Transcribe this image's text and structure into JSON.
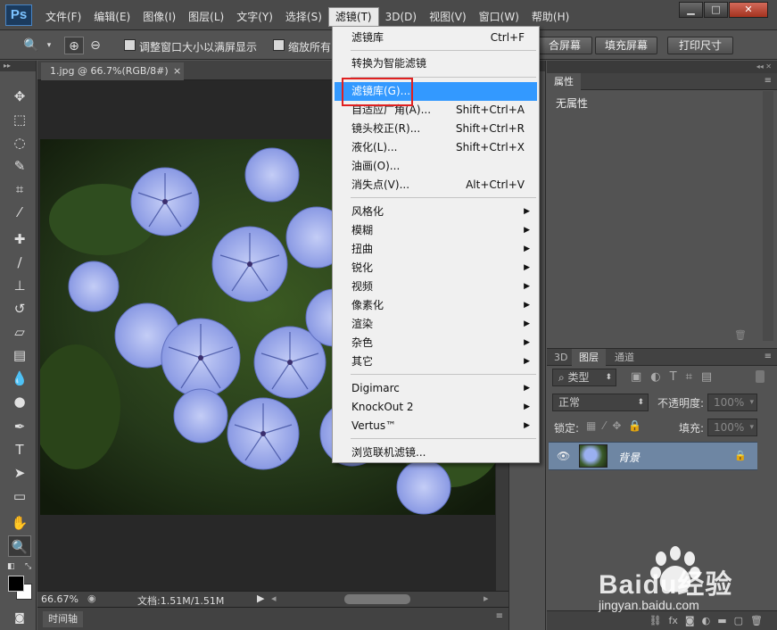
{
  "app": {
    "logo": "Ps"
  },
  "menubar": {
    "items": [
      "文件(F)",
      "编辑(E)",
      "图像(I)",
      "图层(L)",
      "文字(Y)",
      "选择(S)",
      "滤镜(T)",
      "3D(D)",
      "视图(V)",
      "窗口(W)",
      "帮助(H)"
    ],
    "active_index": 6
  },
  "window_controls": {
    "minimize": "▁",
    "maximize": "□",
    "close": "✕"
  },
  "options": {
    "checkbox1_label": "调整窗口大小以满屏显示",
    "checkbox2_label": "缩放所有",
    "btn_fit_screen": "合屏幕",
    "btn_fill_screen": "填充屏幕",
    "btn_print_size": "打印尺寸"
  },
  "document": {
    "tab_title": "1.jpg @ 66.7%(RGB/8#)",
    "tab_close": "×",
    "zoom": "66.67%",
    "doc_info": "文档:1.51M/1.51M"
  },
  "timeline": {
    "label": "时间轴"
  },
  "properties": {
    "tab": "属性",
    "content": "无属性"
  },
  "layers": {
    "tabs": [
      "3D",
      "图层",
      "通道"
    ],
    "active_tab": 1,
    "kind_label": "类型",
    "blend_mode": "正常",
    "opacity_label": "不透明度:",
    "opacity_value": "100%",
    "lock_label": "锁定:",
    "fill_label": "填充:",
    "fill_value": "100%",
    "layer_name": "背景"
  },
  "filter_menu": {
    "items": [
      {
        "label": "滤镜库",
        "shortcut": "Ctrl+F"
      },
      {
        "label": "转换为智能滤镜",
        "shortcut": ""
      },
      {
        "label": "滤镜库(G)...",
        "shortcut": "",
        "highlighted": true
      },
      {
        "label": "自适应广角(A)...",
        "shortcut": "Shift+Ctrl+A"
      },
      {
        "label": "镜头校正(R)...",
        "shortcut": "Shift+Ctrl+R"
      },
      {
        "label": "液化(L)...",
        "shortcut": "Shift+Ctrl+X"
      },
      {
        "label": "油画(O)...",
        "shortcut": ""
      },
      {
        "label": "消失点(V)...",
        "shortcut": "Alt+Ctrl+V"
      },
      {
        "label": "风格化",
        "submenu": true
      },
      {
        "label": "模糊",
        "submenu": true
      },
      {
        "label": "扭曲",
        "submenu": true
      },
      {
        "label": "锐化",
        "submenu": true
      },
      {
        "label": "视频",
        "submenu": true
      },
      {
        "label": "像素化",
        "submenu": true
      },
      {
        "label": "渲染",
        "submenu": true
      },
      {
        "label": "杂色",
        "submenu": true
      },
      {
        "label": "其它",
        "submenu": true
      },
      {
        "label": "Digimarc",
        "submenu": true
      },
      {
        "label": "KnockOut 2",
        "submenu": true
      },
      {
        "label": "Vertus™",
        "submenu": true
      },
      {
        "label": "浏览联机滤镜...",
        "shortcut": ""
      }
    ]
  },
  "watermark": {
    "brand": "Baidu经验",
    "url": "jingyan.baidu.com"
  }
}
